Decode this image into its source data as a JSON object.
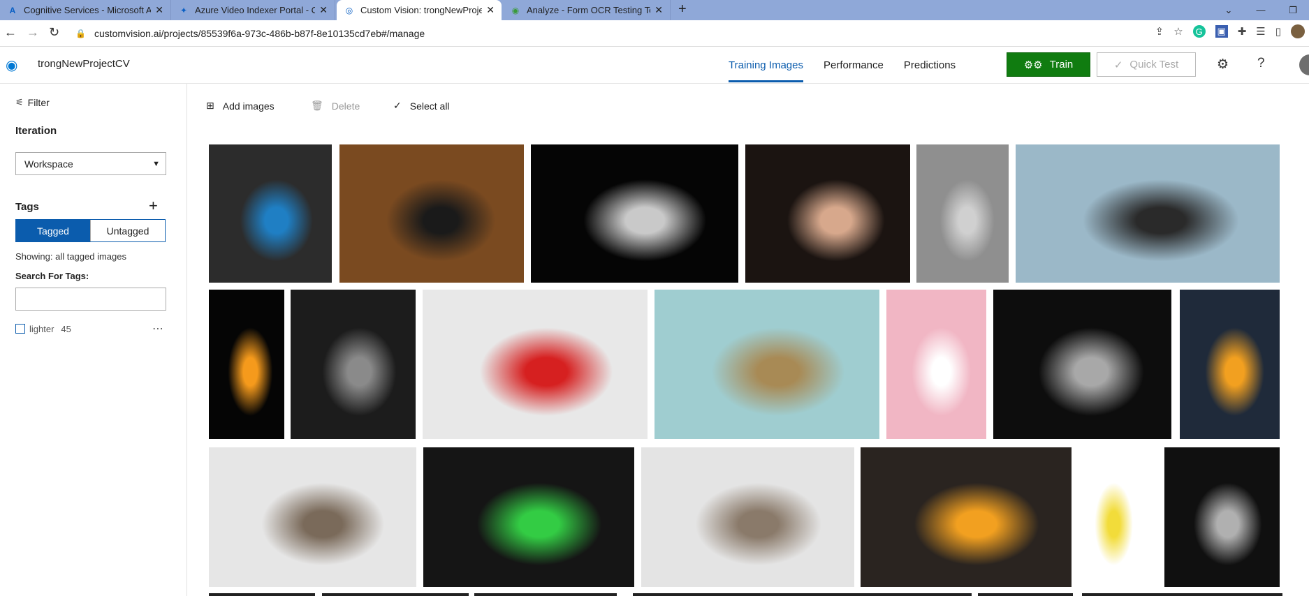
{
  "browser": {
    "tabs": [
      {
        "title": "Cognitive Services - Microsoft Az",
        "icon": "azure-icon"
      },
      {
        "title": "Azure Video Indexer Portal - Cog",
        "icon": "video-indexer-icon"
      },
      {
        "title": "Custom Vision: trongNewProjectC",
        "icon": "custom-vision-icon",
        "active": true
      },
      {
        "title": "Analyze - Form OCR Testing Tool",
        "icon": "ocr-tool-icon"
      }
    ],
    "url": "customvision.ai/projects/85539f6a-973c-486b-b87f-8e10135cd7eb#/manage"
  },
  "header": {
    "project_name": "trongNewProjectCV",
    "nav": [
      {
        "label": "Training Images",
        "active": true
      },
      {
        "label": "Performance",
        "active": false
      },
      {
        "label": "Predictions",
        "active": false
      }
    ],
    "train_label": "Train",
    "quick_test_label": "Quick Test"
  },
  "sidebar": {
    "filter_label": "Filter",
    "iteration_title": "Iteration",
    "iteration_value": "Workspace",
    "tags_title": "Tags",
    "tagged_label": "Tagged",
    "untagged_label": "Untagged",
    "showing_text": "Showing: all tagged images",
    "search_label": "Search For Tags:",
    "search_value": "",
    "tags": [
      {
        "name": "lighter",
        "count": "45"
      }
    ]
  },
  "toolbar": {
    "add_label": "Add images",
    "delete_label": "Delete",
    "select_all_label": "Select all"
  },
  "images": {
    "rows": [
      [
        {
          "bg": "#2c2c2c",
          "accent": "#1f7fc4"
        },
        {
          "bg": "#7a4a20",
          "accent": "#1a1a1a"
        },
        {
          "bg": "#050505",
          "accent": "#c9c9c9"
        },
        {
          "bg": "#1b1411",
          "accent": "#d7a88c"
        },
        {
          "bg": "#8f8f8f",
          "accent": "#d0d0d0"
        },
        {
          "bg": "#9bb8c8",
          "accent": "#2a2a2a"
        }
      ],
      [
        {
          "bg": "#050505",
          "accent": "#f59a1c"
        },
        {
          "bg": "#1c1c1c",
          "accent": "#8a8a8a"
        },
        {
          "bg": "#e8e8e8",
          "accent": "#d62020"
        },
        {
          "bg": "#9fcdd0",
          "accent": "#a88a55"
        },
        {
          "bg": "#f1b6c4",
          "accent": "#ffffff"
        },
        {
          "bg": "#0d0d0d",
          "accent": "#a8a8a8"
        },
        {
          "bg": "#1f2a3a",
          "accent": "#f2a020"
        }
      ],
      [
        {
          "bg": "#e6e6e6",
          "accent": "#7a6a5a"
        },
        {
          "bg": "#151515",
          "accent": "#33cc44"
        },
        {
          "bg": "#e4e4e4",
          "accent": "#8a7a6a"
        },
        {
          "bg": "#2a2420",
          "accent": "#f2a020"
        },
        {
          "bg": "#ffffff",
          "accent": "#f2dc3a"
        },
        {
          "bg": "#101010",
          "accent": "#b0b0b0"
        }
      ]
    ]
  }
}
